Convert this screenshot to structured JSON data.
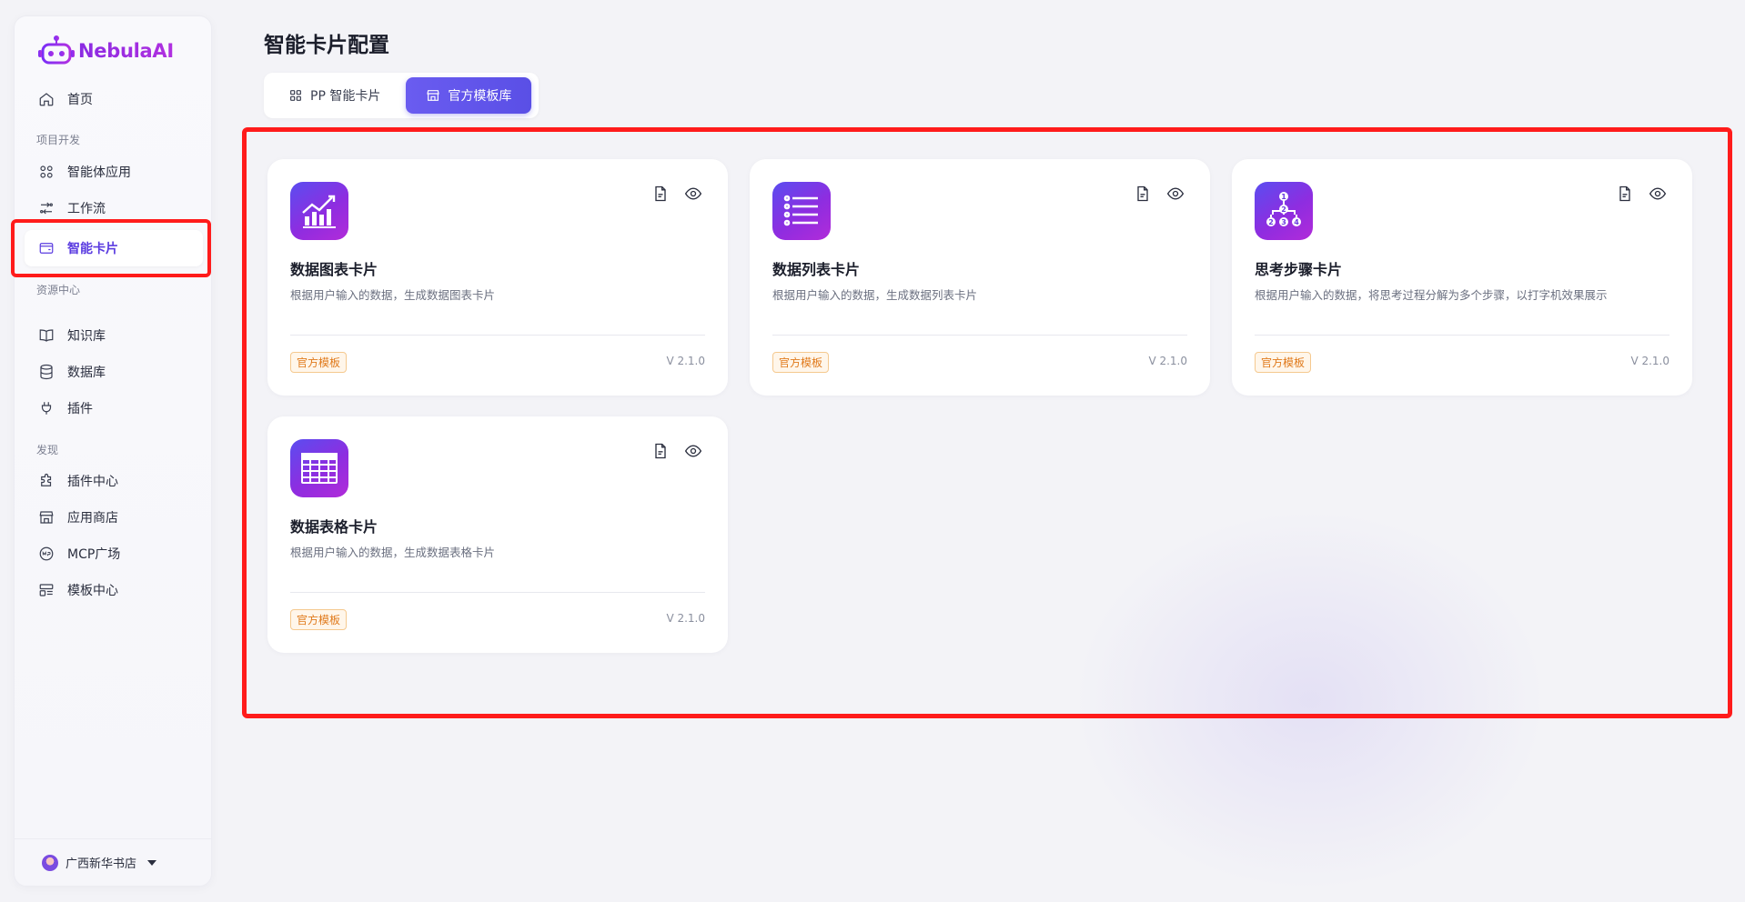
{
  "app": {
    "brand": "NebulaAI"
  },
  "sidebar": {
    "items": [
      {
        "key": "home",
        "label": "首页",
        "icon": "home-icon"
      },
      {
        "key": "section-dev",
        "section": "项目开发"
      },
      {
        "key": "agent",
        "label": "智能体应用",
        "icon": "apps-icon"
      },
      {
        "key": "workflow",
        "label": "工作流",
        "icon": "workflow-icon"
      },
      {
        "key": "cards",
        "label": "智能卡片",
        "icon": "card-icon",
        "active": true
      },
      {
        "key": "section-res",
        "section": "资源中心"
      },
      {
        "key": "knowledge",
        "label": "知识库",
        "icon": "book-icon"
      },
      {
        "key": "database",
        "label": "数据库",
        "icon": "database-icon"
      },
      {
        "key": "plugin",
        "label": "插件",
        "icon": "plug-icon"
      },
      {
        "key": "section-find",
        "section": "发现"
      },
      {
        "key": "plugin-center",
        "label": "插件中心",
        "icon": "puzzle-icon"
      },
      {
        "key": "app-store",
        "label": "应用商店",
        "icon": "store-icon"
      },
      {
        "key": "mcp",
        "label": "MCP广场",
        "icon": "mcp-icon"
      },
      {
        "key": "template",
        "label": "模板中心",
        "icon": "template-icon"
      }
    ],
    "footer": {
      "org": "广西新华书店"
    }
  },
  "main": {
    "title": "智能卡片配置",
    "tabs": [
      {
        "label": "PP 智能卡片",
        "icon": "grid-icon",
        "active": false
      },
      {
        "label": "官方模板库",
        "icon": "store-icon",
        "active": true
      }
    ],
    "cards": [
      {
        "title": "数据图表卡片",
        "desc": "根据用户输入的数据，生成数据图表卡片",
        "badge": "官方模板",
        "version": "V 2.1.0",
        "icon": "chart-icon"
      },
      {
        "title": "数据列表卡片",
        "desc": "根据用户输入的数据，生成数据列表卡片",
        "badge": "官方模板",
        "version": "V 2.1.0",
        "icon": "list-icon"
      },
      {
        "title": "思考步骤卡片",
        "desc": "根据用户输入的数据，将思考过程分解为多个步骤，以打字机效果展示",
        "badge": "官方模板",
        "version": "V 2.1.0",
        "icon": "steps-icon"
      },
      {
        "title": "数据表格卡片",
        "desc": "根据用户输入的数据，生成数据表格卡片",
        "badge": "官方模板",
        "version": "V 2.1.0",
        "icon": "table-icon"
      }
    ]
  },
  "colors": {
    "accent": "#5a4fe6",
    "highlight": "#ff1b1b",
    "badge": "#e07a1c"
  }
}
